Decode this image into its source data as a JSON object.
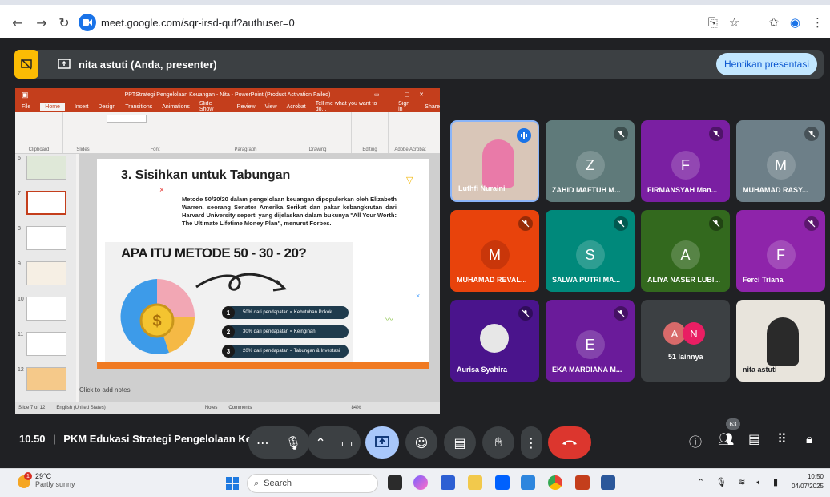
{
  "browser": {
    "url": "meet.google.com/sqr-irsd-quf?authuser=0"
  },
  "presenting": {
    "presenter_label": "nita astuti (Anda, presenter)",
    "stop_label": "Hentikan presentasi"
  },
  "ppt": {
    "window_title": "PPTStrategi Pengelolaan Keuangan - Nita - PowerPoint (Product Activation Failed)",
    "tabs": [
      "File",
      "Home",
      "Insert",
      "Design",
      "Transitions",
      "Animations",
      "Slide Show",
      "Review",
      "View",
      "Acrobat",
      "Tell me what you want to do...",
      "Sign in",
      "Share"
    ],
    "ribbon_groups": [
      "Clipboard",
      "Slides",
      "Font",
      "Paragraph",
      "Drawing",
      "Editing",
      "Adobe Acrobat"
    ],
    "thumb_numbers": [
      "6",
      "7",
      "8",
      "9",
      "10",
      "11",
      "12"
    ],
    "slide": {
      "heading_prefix": "3. ",
      "heading_u1": "Sisihkan",
      "heading_mid": " ",
      "heading_u2": "untuk",
      "heading_end": " Tabungan",
      "paragraph": "Metode 50/30/20 dalam pengelolaan keuangan dipopulerkan oleh Elizabeth Warren, seorang Senator Amerika Serikat dan pakar kebangkrutan dari Harvard University seperti yang dijelaskan dalam bukunya \"All Your Worth: The Ultimate Lifetime Money Plan\", menurut Forbes.",
      "banner_title": "APA ITU METODE 50 - 30 - 20?",
      "items": [
        {
          "num": "1",
          "text": "50% dari pendapatan = Kebutuhan Pokok"
        },
        {
          "num": "2",
          "text": "30% dari pendapatan = Keinginan"
        },
        {
          "num": "3",
          "text": "20% dari pendapatan = Tabungan & Investasi"
        }
      ]
    },
    "notes_placeholder": "Click to add notes",
    "status_slide": "Slide 7 of 12",
    "status_lang": "English (United States)",
    "status_notes": "Notes",
    "status_comments": "Comments",
    "status_zoom": "84%"
  },
  "participants": [
    {
      "name": "Luthfi Nuraini",
      "initial": "",
      "color": "#d9c6b8",
      "muted": false,
      "video": true
    },
    {
      "name": "ZAHID MAFTUH M...",
      "initial": "Z",
      "color": "#5f7a7a",
      "muted": true,
      "video": false
    },
    {
      "name": "FIRMANSYAH Man...",
      "initial": "F",
      "color": "#7a1fa2",
      "muted": true,
      "video": false
    },
    {
      "name": "MUHAMAD RASY...",
      "initial": "M",
      "color": "#6d7f88",
      "muted": true,
      "video": false
    },
    {
      "name": "MUHAMAD REVAL...",
      "initial": "M",
      "color": "#e8430c",
      "muted": true,
      "video": false
    },
    {
      "name": "SALWA PUTRI MA...",
      "initial": "S",
      "color": "#00897b",
      "muted": true,
      "video": false
    },
    {
      "name": "ALIYA NASER LUBI...",
      "initial": "A",
      "color": "#33691e",
      "muted": true,
      "video": false
    },
    {
      "name": "Ferci Triana",
      "initial": "F",
      "color": "#8e24aa",
      "muted": true,
      "video": false
    },
    {
      "name": "Aurisa Syahira",
      "initial": "",
      "color": "#4a148c",
      "muted": true,
      "video": false
    },
    {
      "name": "EKA MARDIANA M...",
      "initial": "E",
      "color": "#6a1b9a",
      "muted": true,
      "video": false
    },
    {
      "name": "51 lainnya",
      "initial": "",
      "color": "#3c4043",
      "muted": false,
      "video": false
    },
    {
      "name": "nita astuti",
      "initial": "",
      "color": "#e8e4dc",
      "muted": false,
      "video": true
    }
  ],
  "others": {
    "a": "A",
    "n": "N"
  },
  "meeting": {
    "time": "10.50",
    "separator": "|",
    "title": "PKM Edukasi Strategi Pengelolaan Ke...",
    "people_count": "63"
  },
  "taskbar": {
    "temp": "29°C",
    "weather": "Partly sunny",
    "weather_badge": "1",
    "search_label": "Search",
    "clock_time": "10:50",
    "clock_date": "04/07/2025"
  }
}
